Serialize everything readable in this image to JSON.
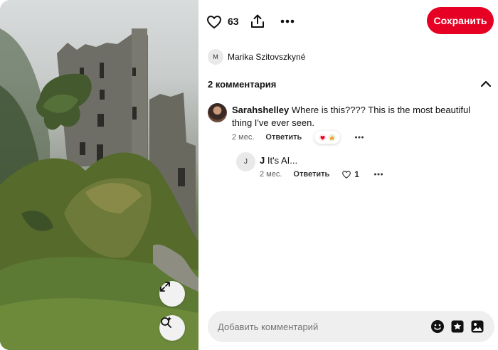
{
  "pin": {
    "like_count": "63",
    "save_label": "Сохранить",
    "author_initial": "M",
    "author_name": "Marika Szitovszkyné"
  },
  "comments": {
    "title": "2 комментария",
    "items": [
      {
        "author": "Sarahshelley",
        "text": "Where is this???? This is the most beautiful thing I've ever seen.",
        "time": "2 мес.",
        "reply_label": "Ответить",
        "reactions": [
          "heart",
          "thumbs-up"
        ]
      },
      {
        "avatar_initial": "J",
        "author": "J",
        "text": "It's AI...",
        "time": "2 мес.",
        "reply_label": "Ответить",
        "likes": "1"
      }
    ]
  },
  "composer": {
    "placeholder": "Добавить комментарий"
  },
  "colors": {
    "save": "#e60023",
    "input_bg": "#efefef",
    "reaction_heart": "#e60023",
    "reaction_thumb": "#f2a33a"
  }
}
